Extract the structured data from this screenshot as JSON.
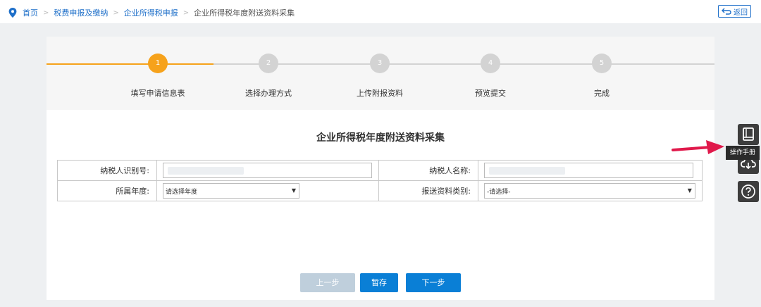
{
  "breadcrumb": {
    "home": "首页",
    "level1": "税费申报及缴纳",
    "level2": "企业所得税申报",
    "current": "企业所得税年度附送资料采集",
    "separator": ">"
  },
  "header": {
    "back_label": "返回"
  },
  "steps": [
    {
      "number": "1",
      "label": "填写申请信息表",
      "state": "active"
    },
    {
      "number": "2",
      "label": "选择办理方式",
      "state": "pending"
    },
    {
      "number": "3",
      "label": "上传附报资料",
      "state": "pending"
    },
    {
      "number": "4",
      "label": "预览提交",
      "state": "pending"
    },
    {
      "number": "5",
      "label": "完成",
      "state": "pending"
    }
  ],
  "form": {
    "title": "企业所得税年度附送资料采集",
    "taxpayer_id_label": "纳税人识别号:",
    "taxpayer_name_label": "纳税人名称:",
    "year_label": "所属年度:",
    "year_select": "请选择年度",
    "doc_type_label": "报送资料类别:",
    "doc_type_select": "-请选择-"
  },
  "buttons": {
    "prev": "上一步",
    "save": "暂存",
    "next": "下一步"
  },
  "side_tools": {
    "manual_tooltip": "操作手册"
  },
  "colors": {
    "accent": "#1e6fc9",
    "step_active": "#f6a21b",
    "button_blue": "#0a7fd6",
    "button_disabled": "#bfcfdc",
    "annotation_arrow": "#e0194b"
  }
}
